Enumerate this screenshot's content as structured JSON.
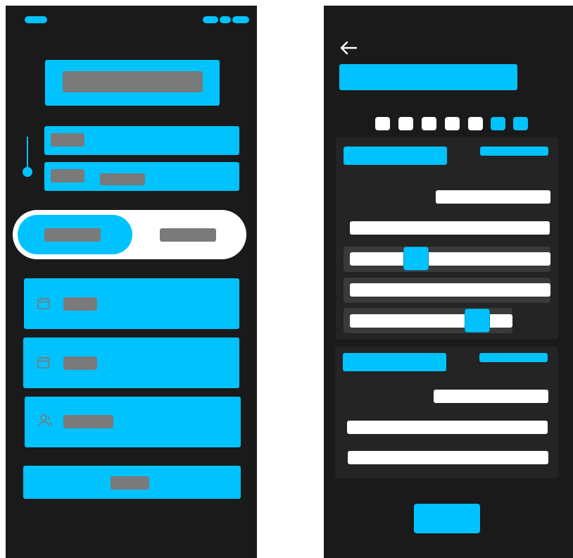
{
  "colors": {
    "accent": "#00c2ff",
    "screen_background": "#1a1a1a",
    "panel_background": "#242424",
    "placeholder": "#7a7a7a",
    "surface_white": "#ffffff"
  },
  "left_screen": {
    "status_bar": {
      "icons": [
        "time-indicator",
        "signal-icon",
        "wifi-icon",
        "battery-icon"
      ]
    },
    "header_card": {
      "title_placeholder": ""
    },
    "route": {
      "icon": "route-line-icon",
      "from_field": {
        "value": ""
      },
      "to_field": {
        "value": ""
      }
    },
    "segmented_toggle": {
      "options": [
        {
          "label": "",
          "selected": true
        },
        {
          "label": "",
          "selected": false
        }
      ]
    },
    "fields": [
      {
        "icon": "calendar-icon",
        "value": ""
      },
      {
        "icon": "calendar-icon",
        "value": ""
      },
      {
        "icon": "passengers-icon",
        "value": ""
      }
    ],
    "primary_button": {
      "label": ""
    }
  },
  "right_screen": {
    "back_button": {
      "icon": "arrow-left-icon"
    },
    "title": "",
    "pager": {
      "total": 7,
      "active": [
        6,
        7
      ]
    },
    "sections": [
      {
        "title": "",
        "action": "",
        "rows": [
          {
            "kind": "text"
          },
          {
            "kind": "text"
          },
          {
            "kind": "slider",
            "level": 0.33
          },
          {
            "kind": "text"
          },
          {
            "kind": "slider",
            "level": 0.78
          }
        ]
      },
      {
        "title": "",
        "action": "",
        "rows": [
          {
            "kind": "text"
          },
          {
            "kind": "text"
          },
          {
            "kind": "text"
          }
        ]
      }
    ],
    "submit_button": {
      "label": ""
    }
  }
}
